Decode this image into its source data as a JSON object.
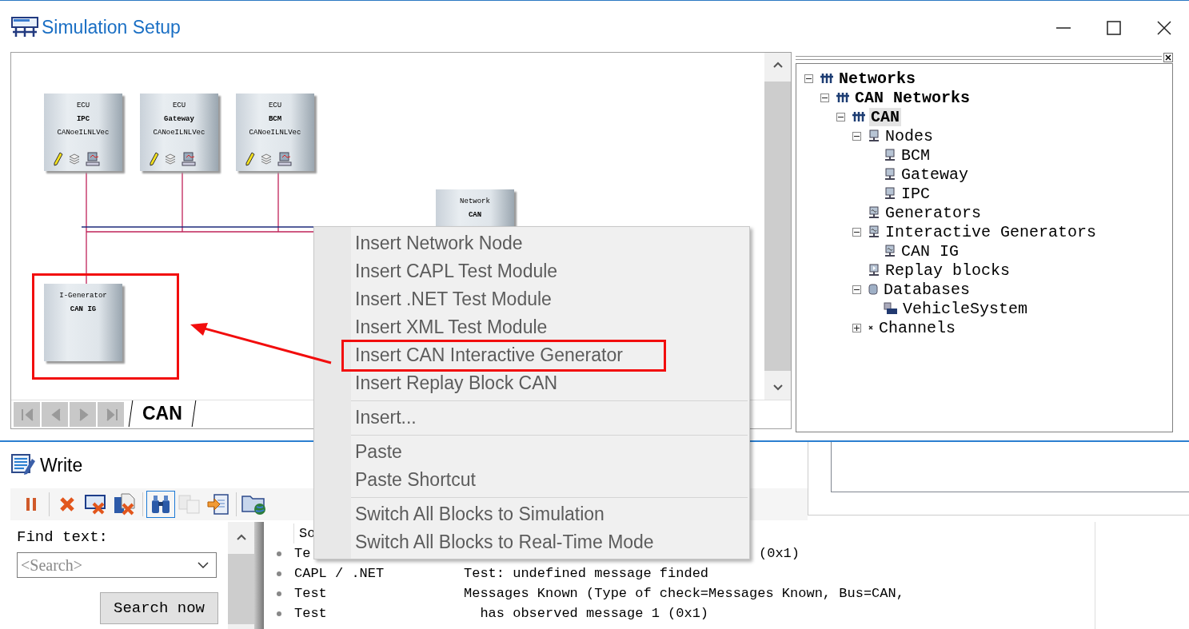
{
  "window": {
    "title": "Simulation Setup"
  },
  "canvas": {
    "nodes": [
      {
        "kind": "ecu",
        "type_label": "ECU",
        "name": "IPC",
        "subtitle": "CANoeILNLVec"
      },
      {
        "kind": "ecu",
        "type_label": "ECU",
        "name": "Gateway",
        "subtitle": "CANoeILNLVec"
      },
      {
        "kind": "ecu",
        "type_label": "ECU",
        "name": "BCM",
        "subtitle": "CANoeILNLVec"
      },
      {
        "kind": "network",
        "type_label": "Network",
        "name": "CAN"
      },
      {
        "kind": "generator",
        "type_label": "I-Generator",
        "name": "CAN IG",
        "marked": true
      }
    ],
    "tabs": [
      {
        "label": "CAN",
        "selected": true
      }
    ]
  },
  "tree": [
    {
      "label": "Networks",
      "kind": "network",
      "selected": false,
      "expanded": true,
      "children": [
        {
          "label": "CAN Networks",
          "kind": "network",
          "selected": false,
          "expanded": true,
          "children": [
            {
              "label": "CAN",
              "kind": "network",
              "selected": true,
              "expanded": true,
              "children": [
                {
                  "label": "Nodes",
                  "kind": "node",
                  "selected": false,
                  "expanded": true,
                  "children": [
                    {
                      "label": "BCM",
                      "kind": "node",
                      "selected": false
                    },
                    {
                      "label": "Gateway",
                      "kind": "node",
                      "selected": false
                    },
                    {
                      "label": "IPC",
                      "kind": "node",
                      "selected": false
                    }
                  ]
                },
                {
                  "label": "Generators",
                  "kind": "generator",
                  "selected": false
                },
                {
                  "label": "Interactive Generators",
                  "kind": "generator",
                  "selected": false,
                  "expanded": true,
                  "children": [
                    {
                      "label": "CAN IG",
                      "kind": "generator",
                      "selected": false
                    }
                  ]
                },
                {
                  "label": "Replay blocks",
                  "kind": "replay",
                  "selected": false
                },
                {
                  "label": "Databases",
                  "kind": "database",
                  "selected": false,
                  "expanded": true,
                  "children": [
                    {
                      "label": "VehicleSystem",
                      "kind": "dbc",
                      "selected": false
                    }
                  ]
                },
                {
                  "label": "Channels",
                  "kind": "channel",
                  "selected": false,
                  "expanded": false
                }
              ]
            }
          ]
        }
      ]
    }
  ],
  "context_menu": {
    "groups": [
      [
        {
          "label": "Insert Network Node",
          "marked": false
        },
        {
          "label": "Insert CAPL Test Module",
          "marked": false
        },
        {
          "label": "Insert .NET Test Module",
          "marked": false
        },
        {
          "label": "Insert XML Test Module",
          "marked": false
        },
        {
          "label": "Insert CAN Interactive Generator",
          "marked": true
        },
        {
          "label": "Insert Replay Block CAN",
          "marked": false
        }
      ],
      [
        {
          "label": "Insert...",
          "marked": false
        }
      ],
      [
        {
          "label": "Paste",
          "marked": false
        },
        {
          "label": "Paste Shortcut",
          "marked": false
        }
      ],
      [
        {
          "label": "Switch All Blocks to Simulation",
          "marked": false
        },
        {
          "label": "Switch All Blocks to Real-Time Mode",
          "marked": false
        }
      ]
    ]
  },
  "write_panel": {
    "title": "Write",
    "toolbar": [
      [
        {
          "kind": "pause",
          "selected": false,
          "disabled": false
        }
      ],
      [
        {
          "kind": "delete",
          "selected": false,
          "disabled": false
        },
        {
          "kind": "clear-window",
          "selected": false,
          "disabled": false
        },
        {
          "kind": "clear-file",
          "selected": false,
          "disabled": false
        }
      ],
      [
        {
          "kind": "find",
          "selected": true,
          "disabled": false
        },
        {
          "kind": "copy",
          "selected": false,
          "disabled": true
        },
        {
          "kind": "import",
          "selected": false,
          "disabled": false
        }
      ],
      [
        {
          "kind": "folder-globe",
          "selected": false,
          "disabled": false
        }
      ]
    ],
    "find_label": "Find text:",
    "search": {
      "placeholder": "<Search>"
    },
    "search_button": "Search now",
    "log": {
      "header": "So",
      "rows": [
        {
          "kind": "covered",
          "source": "Te",
          "message": "(0x1)"
        },
        {
          "kind": "full",
          "source": "CAPL / .NET",
          "message": "Test: undefined message finded"
        },
        {
          "kind": "full",
          "source": "Test",
          "message": "Messages Known (Type of check=Messages Known, Bus=CAN,"
        },
        {
          "kind": "full",
          "source": "Test",
          "message": "  has observed message 1 (0x1)"
        }
      ]
    }
  }
}
